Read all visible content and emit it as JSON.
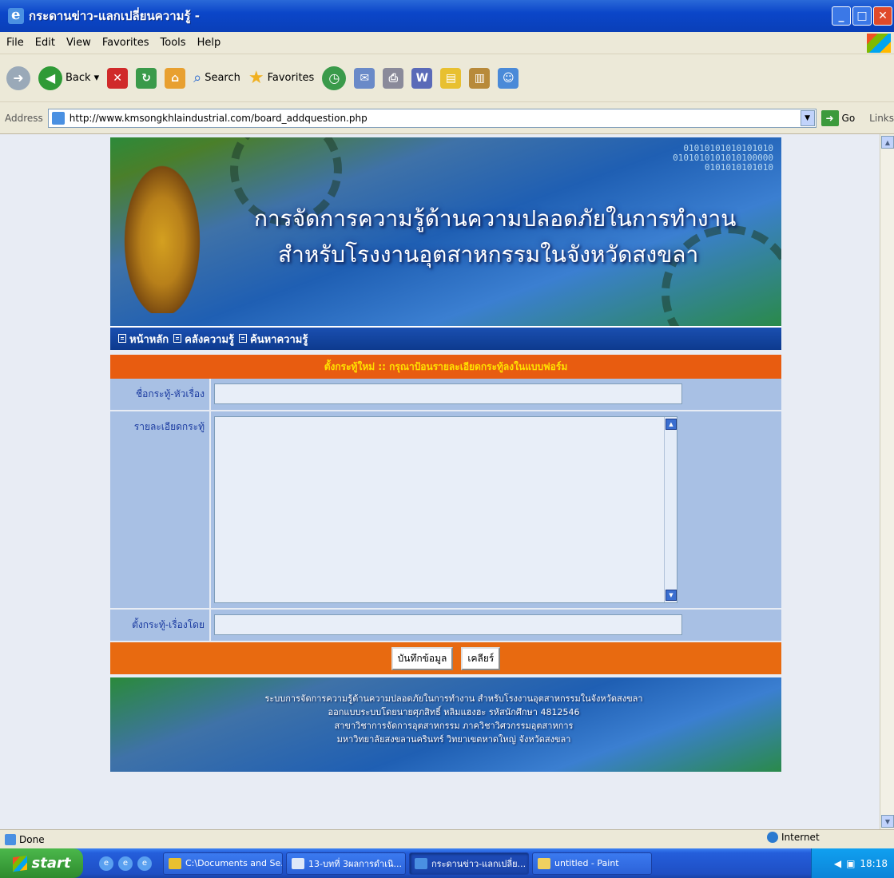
{
  "window": {
    "title": "กระดานข่าว-แลกเปลี่ยนความรู้ -"
  },
  "menu": [
    "File",
    "Edit",
    "View",
    "Favorites",
    "Tools",
    "Help"
  ],
  "toolbar": {
    "back": "Back",
    "search": "Search",
    "favorites": "Favorites"
  },
  "address": {
    "label": "Address",
    "url": "http://www.kmsongkhlaindustrial.com/board_addquestion.php",
    "go": "Go",
    "links": "Links"
  },
  "banner": {
    "line1": "การจัดการความรู้ด้านความปลอดภัยในการทำงาน",
    "line2": "สำหรับโรงงานอุตสาหกรรมในจังหวัดสงขลา",
    "binary": [
      "01010101010101010",
      "0101010101010100000",
      "0101010101010"
    ]
  },
  "nav": [
    "หน้าหลัก",
    "คลังความรู้",
    "ค้นหาความรู้"
  ],
  "form": {
    "header": "ตั้งกระทู้ใหม่ :: กรุณาป้อนรายละเอียดกระทู้ลงในแบบฟอร์ม",
    "title_label": "ชื่อกระทู้-หัวเรื่อง",
    "detail_label": "รายละเอียดกระทู้",
    "author_label": "ตั้งกระทู้-เรื่องโดย",
    "title_value": "",
    "detail_value": "",
    "author_value": "",
    "save_button": "บันทึกข้อมูล",
    "clear_button": "เคลียร์"
  },
  "footer": {
    "lines": [
      "ระบบการจัดการความรู้ด้านความปลอดภัยในการทำงาน สำหรับโรงงานอุตสาหกรรมในจังหวัดสงขลา",
      "ออกแบบระบบโดยนายศุภสิทธิ์ หลิมแฮงฮะ รหัสนักศึกษา 4812546",
      "สาขาวิชาการจัดการอุตสาหกรรม ภาควิชาวิศวกรรมอุตสาหการ",
      "มหาวิทยาลัยสงขลานครินทร์ วิทยาเขตหาดใหญ่ จังหวัดสงขลา"
    ]
  },
  "status": {
    "text": "Done",
    "zone": "Internet"
  },
  "taskbar": {
    "start": "start",
    "tasks": [
      "C:\\Documents and Se...",
      "13-บทที่ 3ผลการดำเนิ...",
      "กระดานข่าว-แลกเปลี่ย...",
      "untitled - Paint"
    ],
    "clock": "18:18"
  }
}
